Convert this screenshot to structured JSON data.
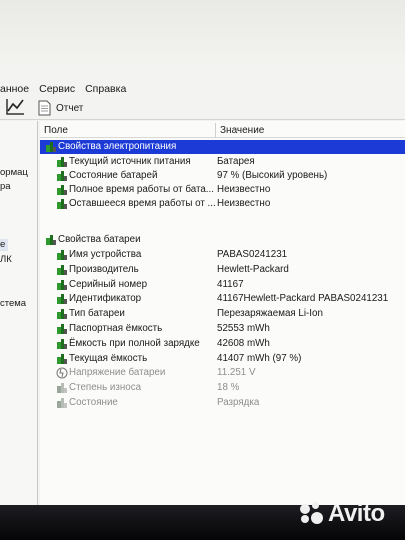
{
  "menu": {
    "items": [
      "анное",
      "Сервис",
      "Справка"
    ]
  },
  "toolbar": {
    "report_label": "Отчет"
  },
  "left_pane": {
    "fragments": [
      "ормац",
      "ра",
      "е",
      "ЛК",
      "стема"
    ]
  },
  "table": {
    "header_field": "Поле",
    "header_value": "Значение",
    "power_section": {
      "title": "Свойства электропитания",
      "rows": [
        {
          "label": "Текущий источник питания",
          "value": "Батарея",
          "icon": "battery-icon"
        },
        {
          "label": "Состояние батарей",
          "value": "97 % (Высокий уровень)",
          "icon": "battery-icon"
        },
        {
          "label": "Полное время работы от бата...",
          "value": "Неизвестно",
          "icon": "battery-icon"
        },
        {
          "label": "Оставшееся время работы от ...",
          "value": "Неизвестно",
          "icon": "battery-icon"
        }
      ]
    },
    "battery_section": {
      "title": "Свойства батареи",
      "rows": [
        {
          "label": "Имя устройства",
          "value": "PABAS0241231",
          "icon": "battery-icon",
          "dim": false
        },
        {
          "label": "Производитель",
          "value": "Hewlett-Packard",
          "icon": "battery-icon",
          "dim": false
        },
        {
          "label": "Серийный номер",
          "value": "41167",
          "icon": "battery-icon",
          "dim": false
        },
        {
          "label": "Идентификатор",
          "value": "41167Hewlett-Packard PABAS0241231",
          "icon": "battery-icon",
          "dim": false
        },
        {
          "label": "Тип батареи",
          "value": "Перезаряжаемая Li-Ion",
          "icon": "battery-icon",
          "dim": false
        },
        {
          "label": "Паспортная ёмкость",
          "value": "52553 mWh",
          "icon": "battery-icon",
          "dim": false
        },
        {
          "label": "Ёмкость при полной зарядке",
          "value": "42608 mWh",
          "icon": "battery-icon",
          "dim": false
        },
        {
          "label": "Текущая ёмкость",
          "value": "41407 mWh  (97 %)",
          "icon": "battery-icon",
          "dim": false
        },
        {
          "label": "Напряжение батареи",
          "value": "11.251 V",
          "icon": "voltage-icon",
          "dim": true
        },
        {
          "label": "Степень износа",
          "value": "18 %",
          "icon": "battery-icon",
          "dim": true
        },
        {
          "label": "Состояние",
          "value": "Разрядка",
          "icon": "battery-icon",
          "dim": true
        }
      ]
    }
  },
  "watermark": {
    "text": "Avito"
  },
  "colors": {
    "selection": "#1c3ad6",
    "battery_green": "#2e9a2e"
  }
}
